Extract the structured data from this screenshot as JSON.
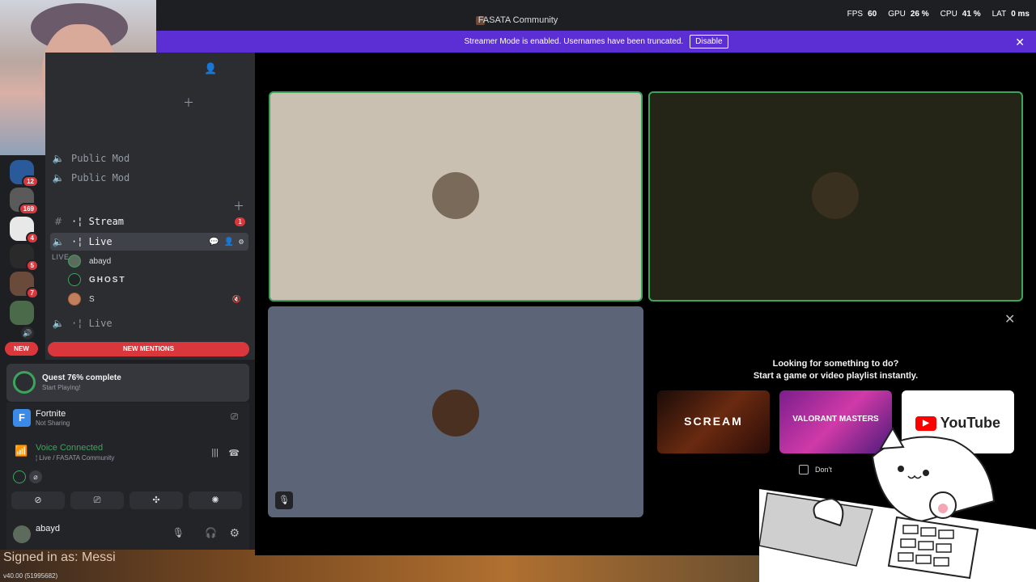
{
  "titlebar": {
    "title": "FASATA Community"
  },
  "overlay": {
    "fps_label": "FPS",
    "fps": "60",
    "gpu_label": "GPU",
    "gpu": "26 %",
    "cpu_label": "CPU",
    "cpu": "41 %",
    "lat_label": "LAT",
    "lat": "0 ms"
  },
  "streamer": {
    "message": "Streamer Mode is enabled. Usernames have been truncated.",
    "disable_label": "Disable"
  },
  "guilds": [
    {
      "badge": "12"
    },
    {
      "badge": "169"
    },
    {
      "badge": "4"
    },
    {
      "badge": "5"
    },
    {
      "badge": "7"
    },
    {
      "badge": ""
    }
  ],
  "guild_new_label": "NEW",
  "channels": {
    "public1": "Public Mod",
    "public2": "Public Mod",
    "live_header": "LIVE ⌄",
    "stream": "¦ Stream",
    "stream_badge": "1",
    "live_active": "¦ Live",
    "live_other": "¦ Live",
    "prefix": "· "
  },
  "voice_users": [
    {
      "name": "abayd"
    },
    {
      "name": "GHOST"
    },
    {
      "name": "S"
    }
  ],
  "new_mentions": "NEW MENTIONS",
  "quest": {
    "title": "Quest 76% complete",
    "subtitle": "Start Playing!",
    "progress": 0.76
  },
  "game": {
    "name": "Fortnite",
    "status": "Not Sharing"
  },
  "voice": {
    "status": "Voice Connected",
    "location": "¦ Live / FASATA Community"
  },
  "user": {
    "name": "abayd"
  },
  "footer": {
    "signed_in": "Signed in as:  Messi",
    "version": "v40.00 (51995682)"
  },
  "activity": {
    "line1": "Looking for something to do?",
    "line2": "Start a game or video playlist instantly.",
    "thumbs": [
      {
        "label": "SCREAM"
      },
      {
        "label": "VALORANT MASTERS"
      },
      {
        "label": "YouTube"
      }
    ],
    "checkbox_label": "Don't"
  },
  "colors": {
    "accent": "#5c2fd4",
    "green": "#3ba55c",
    "red": "#da373c"
  }
}
